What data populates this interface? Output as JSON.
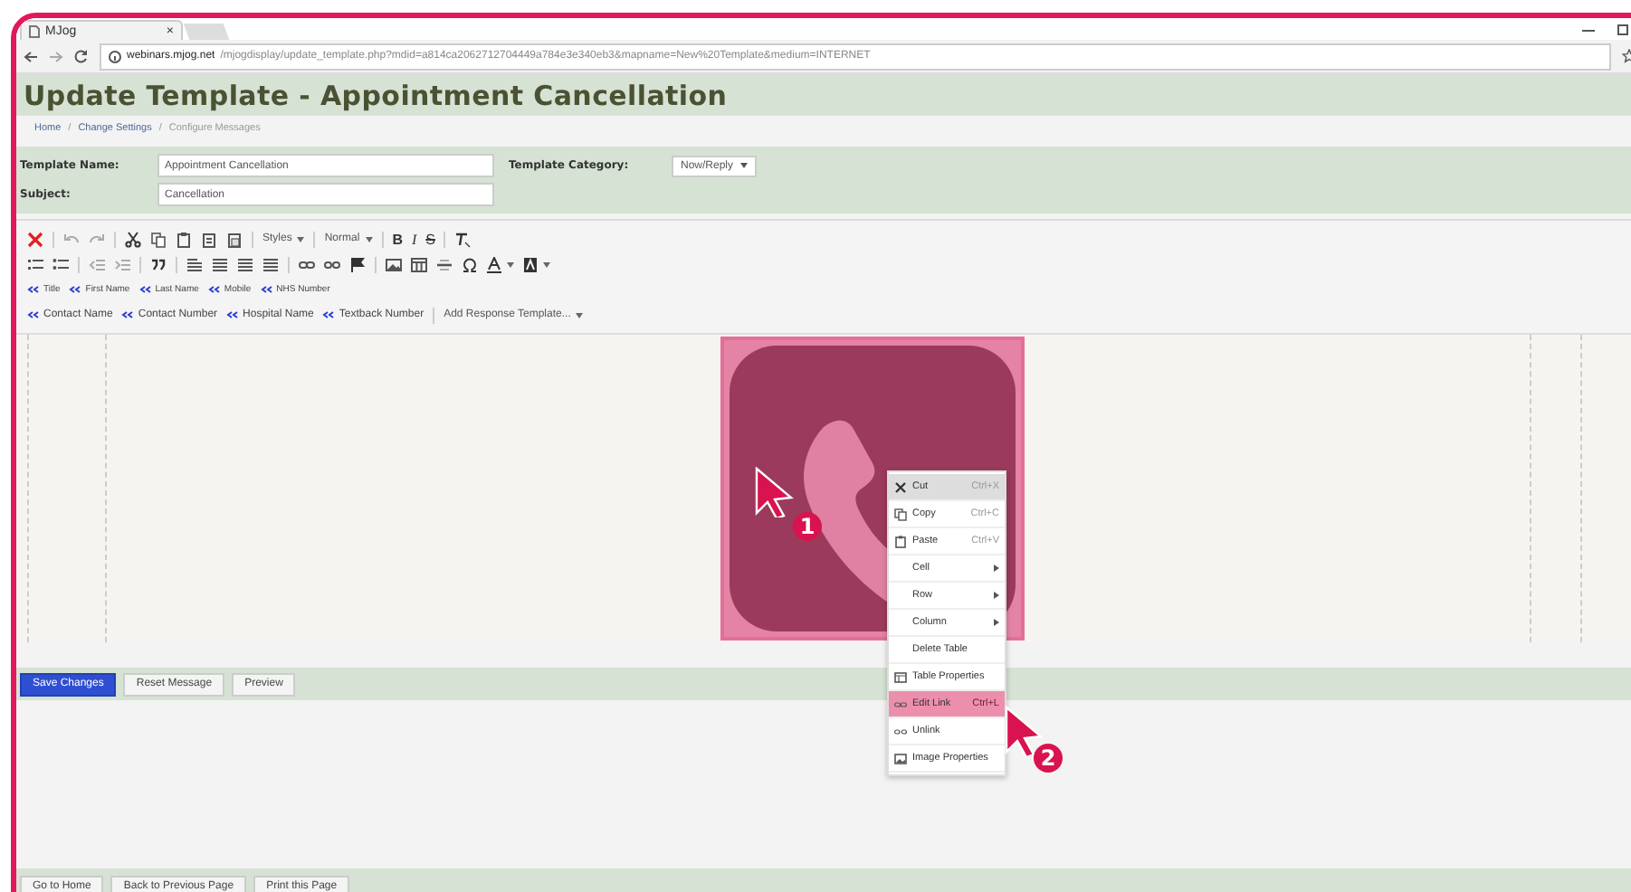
{
  "browser": {
    "tab_title": "MJog",
    "tab_close": "×",
    "url_host": "webinars.mjog.net",
    "url_path": "/mjogdisplay/update_template.php?mdid=a814ca2062712704449a784e3e340eb3&mapname=New%20Template&medium=INTERNET"
  },
  "page": {
    "title": "Update Template - Appointment Cancellation",
    "breadcrumb": [
      {
        "label": "Home",
        "link": true
      },
      {
        "label": "Change Settings",
        "link": true
      },
      {
        "label": "Configure Messages",
        "link": false
      }
    ],
    "breadcrumb_separator": "/"
  },
  "form": {
    "template_name_label": "Template Name:",
    "template_name_value": "Appointment Cancellation",
    "category_label": "Template Category:",
    "category_value": "Now/Reply",
    "subject_label": "Subject:",
    "subject_value": "Cancellation"
  },
  "toolbar": {
    "styles": "Styles",
    "format": "Normal",
    "bold": "B",
    "italic": "I",
    "strike": "S",
    "fields_row_1": [
      "Title",
      "First Name",
      "Last Name",
      "Mobile",
      "NHS Number"
    ],
    "fields_row_2": [
      "Contact Name",
      "Contact Number",
      "Hospital Name",
      "Textback Number"
    ],
    "response_template": "Add Response Template..."
  },
  "context_menu": [
    {
      "label": "Cut",
      "shortcut": "Ctrl+X",
      "kind": "icon",
      "hover": true,
      "selected": false
    },
    {
      "label": "Copy",
      "shortcut": "Ctrl+C",
      "kind": "icon",
      "hover": false,
      "selected": false
    },
    {
      "label": "Paste",
      "shortcut": "Ctrl+V",
      "kind": "icon",
      "hover": false,
      "selected": false
    },
    {
      "label": "Cell",
      "kind": "submenu",
      "hover": false,
      "selected": false
    },
    {
      "label": "Row",
      "kind": "submenu",
      "hover": false,
      "selected": false
    },
    {
      "label": "Column",
      "kind": "submenu",
      "hover": false,
      "selected": false
    },
    {
      "label": "Delete Table",
      "kind": "plain",
      "hover": false,
      "selected": false
    },
    {
      "label": "Table Properties",
      "kind": "icon",
      "hover": false,
      "selected": false
    },
    {
      "label": "Edit Link",
      "shortcut": "Ctrl+L",
      "kind": "icon",
      "hover": false,
      "selected": true
    },
    {
      "label": "Unlink",
      "kind": "icon",
      "hover": false,
      "selected": false
    },
    {
      "label": "Image Properties",
      "kind": "icon",
      "hover": false,
      "selected": false
    }
  ],
  "actions": [
    {
      "label": "Save Changes",
      "primary": true
    },
    {
      "label": "Reset Message",
      "primary": false
    },
    {
      "label": "Preview",
      "primary": false
    }
  ],
  "footer_buttons": [
    "Go to Home",
    "Back to Previous Page",
    "Print this Page"
  ],
  "annotations": [
    {
      "number": "1"
    },
    {
      "number": "2"
    }
  ]
}
